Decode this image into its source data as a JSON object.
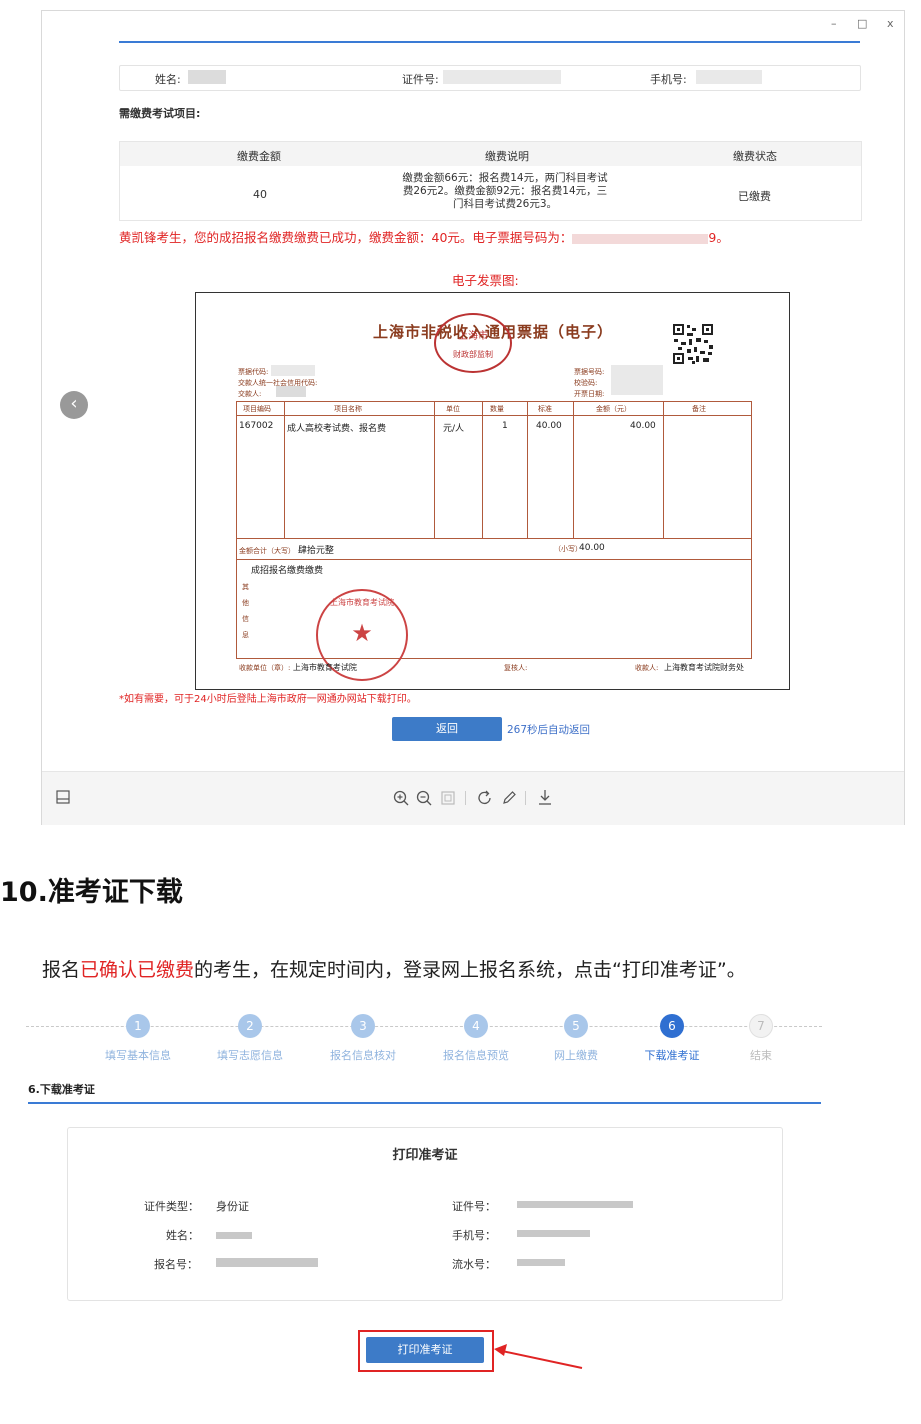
{
  "window": {
    "controls": [
      "–",
      "□",
      "x"
    ],
    "info_row": {
      "name_label": "姓名:",
      "id_label": "证件号:",
      "phone_label": "手机号:"
    },
    "exam_items_label": "需缴费考试项目:",
    "fee_table": {
      "headers": [
        "缴费金额",
        "缴费说明",
        "缴费状态"
      ],
      "row": {
        "amount": "40",
        "desc_lines": [
          "缴费金额66元：报名费14元，两门科目考试",
          "费26元2。缴费金额92元：报名费14元，三",
          "门科目考试费26元3。"
        ],
        "status": "已缴费"
      }
    },
    "success_msg_prefix": "黄凯锋考生，您的成招报名缴费缴费已成功，缴费金额：40元。电子票据号码为：",
    "success_msg_suffix": "9。",
    "invoice_title": "电子发票图:",
    "invoice": {
      "heading": "上海市非税收入通用票据（电子）",
      "left_fields": [
        "票据代码:",
        "交款人统一社会信用代码:",
        "交款人:"
      ],
      "right_fields": [
        "票据号码:",
        "校验码:",
        "开票日期:"
      ],
      "columns": [
        "项目编码",
        "项目名称",
        "单位",
        "数量",
        "标准",
        "金额（元）",
        "备注"
      ],
      "row": {
        "code": "167002",
        "name": "成人高校考试费、报名费",
        "unit": "元/人",
        "qty": "1",
        "std": "40.00",
        "amount": "40.00"
      },
      "total_label": "金额合计（大写）",
      "total_upper": "肆拾元整",
      "total_lower_label": "（小写）",
      "total_lower": "40.00",
      "other_label": "其他信息",
      "other_text": "成招报名缴费缴费",
      "payee_unit_label": "收款单位（章）:",
      "payee_unit": "上海市教育考试院",
      "reviewer_label": "复核人:",
      "receiver_label": "收款人:",
      "receiver": "上海教育考试院财务处",
      "stamp_top": "上海市",
      "stamp_bottom": "财政部监制",
      "stamp2_text": "上海市教育考试院"
    },
    "note": "*如有需要，可于24小时后登陆上海市政府一网通办网站下载打印。",
    "return_btn": "返回",
    "countdown": "267秒后自动返回",
    "toolbar_icons": [
      "zoom-in-icon",
      "zoom-out-icon",
      "fit-icon",
      "rotate-icon",
      "edit-icon",
      "download-icon"
    ]
  },
  "section": {
    "title": "10.准考证下载",
    "text_prefix": "报名",
    "text_highlight": "已确认已缴费",
    "text_suffix": "的考生，在规定时间内，登录网上报名系统，点击“打印准考证”。"
  },
  "steps": [
    {
      "num": "1",
      "label": "填写基本信息"
    },
    {
      "num": "2",
      "label": "填写志愿信息"
    },
    {
      "num": "3",
      "label": "报名信息核对"
    },
    {
      "num": "4",
      "label": "报名信息预览"
    },
    {
      "num": "5",
      "label": "网上缴费"
    },
    {
      "num": "6",
      "label": "下载准考证"
    },
    {
      "num": "7",
      "label": "结束"
    }
  ],
  "download": {
    "heading": "6.下载准考证",
    "card_title": "打印准考证",
    "fields_left": [
      "证件类型：",
      "姓名：",
      "报名号："
    ],
    "id_type_value": "身份证",
    "fields_right": [
      "证件号：",
      "手机号：",
      "流水号："
    ],
    "print_button": "打印准考证"
  },
  "colors": {
    "accent": "#3d7bc8",
    "highlight": "#e02424"
  }
}
